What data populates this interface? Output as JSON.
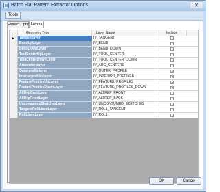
{
  "window": {
    "title": "Batch Flat Pattern Extractor Options",
    "close_glyph": "✕"
  },
  "menu": {
    "tools": "Tools"
  },
  "tabs": [
    {
      "label": "Extract Options",
      "active": false
    },
    {
      "label": "Layers",
      "active": true
    }
  ],
  "grid": {
    "headers": {
      "geometry_type": "Geometry Type",
      "layer_name": "Layer Name",
      "include": "Include"
    },
    "rows": [
      {
        "geometry": "Tangentlayer",
        "layer": "IV_TANGENT",
        "include": false,
        "selected": true
      },
      {
        "geometry": "BendUpLayer",
        "layer": "IV_BEND",
        "include": false
      },
      {
        "geometry": "BendDownLayer",
        "layer": "IV_BEND_DOWN",
        "include": false
      },
      {
        "geometry": "ToolCenterUpLayer",
        "layer": "IV_TOOL_CENTER",
        "include": false
      },
      {
        "geometry": "ToolCenterDownLayer",
        "layer": "IV_TOOL_CENTER_DOWN",
        "include": false
      },
      {
        "geometry": "Arccenterslayer",
        "layer": "IV_ARC_CENTERS",
        "include": false
      },
      {
        "geometry": "Outerprofilelayer",
        "layer": "IV_OUTER_PROFILE",
        "include": true
      },
      {
        "geometry": "Interiorprofileslayer",
        "layer": "IV_INTERIOR_PROFILES",
        "include": true
      },
      {
        "geometry": "FeatureProfilesUpLayer",
        "layer": "IV_FEATURE_PROFILES",
        "include": true
      },
      {
        "geometry": "FeatureProfilesDownLayer",
        "layer": "IV_FEATURE_PROFILES_DOWN",
        "include": true
      },
      {
        "geometry": "AltRepBackLayer",
        "layer": "IV_ALTREP_FRONT",
        "include": false
      },
      {
        "geometry": "AltRepFrontLayer",
        "layer": "IV_ALTREP_BACK",
        "include": false
      },
      {
        "geometry": "UnconsumedSketchesLayer",
        "layer": "IV_UNCONSUMED_SKETCHES",
        "include": false
      },
      {
        "geometry": "TangentRollLinesLayer",
        "layer": "IV_ROLL_TANGENT",
        "include": false
      },
      {
        "geometry": "RollLinesLayer",
        "layer": "IV_ROLL",
        "include": false
      }
    ]
  },
  "buttons": {
    "ok": "OK",
    "cancel": "Cancel"
  },
  "icons": {
    "row_indicator": "▶",
    "check": "✓"
  }
}
